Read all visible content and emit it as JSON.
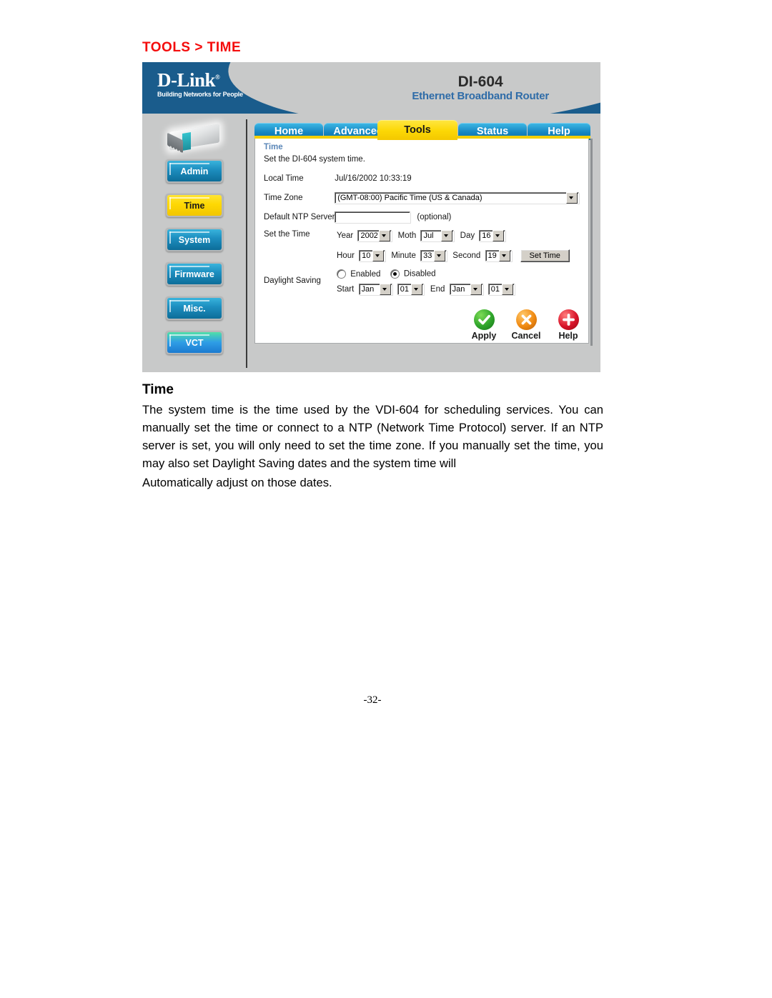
{
  "page": {
    "heading": "TOOLS > TIME",
    "number": "-32-"
  },
  "router_ui": {
    "brand": {
      "name": "D-Link",
      "registered": "®",
      "tagline": "Building Networks for People",
      "model": "DI-604",
      "model_desc": "Ethernet Broadband Router"
    },
    "tabs": [
      {
        "label": "Home",
        "active": false
      },
      {
        "label": "Advanced",
        "active": false
      },
      {
        "label": "Tools",
        "active": true
      },
      {
        "label": "Status",
        "active": false
      },
      {
        "label": "Help",
        "active": false
      }
    ],
    "sidebar": {
      "device_icon": "router-device-image",
      "items": [
        {
          "label": "Admin",
          "style": "blue",
          "selected": false
        },
        {
          "label": "Time",
          "style": "yellow",
          "selected": true
        },
        {
          "label": "System",
          "style": "blue",
          "selected": false
        },
        {
          "label": "Firmware",
          "style": "blue",
          "selected": false
        },
        {
          "label": "Misc.",
          "style": "blue",
          "selected": false
        },
        {
          "label": "VCT",
          "style": "vct",
          "selected": false
        }
      ]
    },
    "content": {
      "section_title": "Time",
      "section_subtitle": "Set the DI-604 system time.",
      "local_time_label": "Local Time",
      "local_time_value": "Jul/16/2002 10:33:19",
      "time_zone_label": "Time Zone",
      "time_zone_value": "(GMT-08:00) Pacific Time (US & Canada)",
      "ntp_label": "Default NTP Server",
      "ntp_value": "",
      "ntp_hint": "(optional)",
      "set_time_label": "Set the Time",
      "year_label": "Year",
      "year_value": "2002",
      "month_label": "Moth",
      "month_value": "Jul",
      "day_label": "Day",
      "day_value": "16",
      "hour_label": "Hour",
      "hour_value": "10",
      "minute_label": "Minute",
      "minute_value": "33",
      "second_label": "Second",
      "second_value": "19",
      "set_time_button": "Set Time",
      "daylight_label": "Daylight Saving",
      "daylight_enabled_label": "Enabled",
      "daylight_disabled_label": "Disabled",
      "daylight_selected": "Disabled",
      "start_label": "Start",
      "start_month": "Jan",
      "start_day": "01",
      "end_label": "End",
      "end_month": "Jan",
      "end_day": "01"
    },
    "actions": [
      {
        "label": "Apply",
        "icon": "check-circle-icon",
        "color": "#2ea42a"
      },
      {
        "label": "Cancel",
        "icon": "x-circle-icon",
        "color": "#f08a12"
      },
      {
        "label": "Help",
        "icon": "plus-circle-icon",
        "color": "#d8142a"
      }
    ]
  },
  "document": {
    "title": "Time",
    "paragraph": "The system time is the time used by the VDI-604 for scheduling services. You can manually set the time or connect to a NTP (Network Time Protocol) server. If an NTP server is set, you will only need to set the time zone. If you manually set the time, you may also set Daylight Saving dates and the system time will",
    "paragraph2": "Automatically adjust on those dates."
  }
}
